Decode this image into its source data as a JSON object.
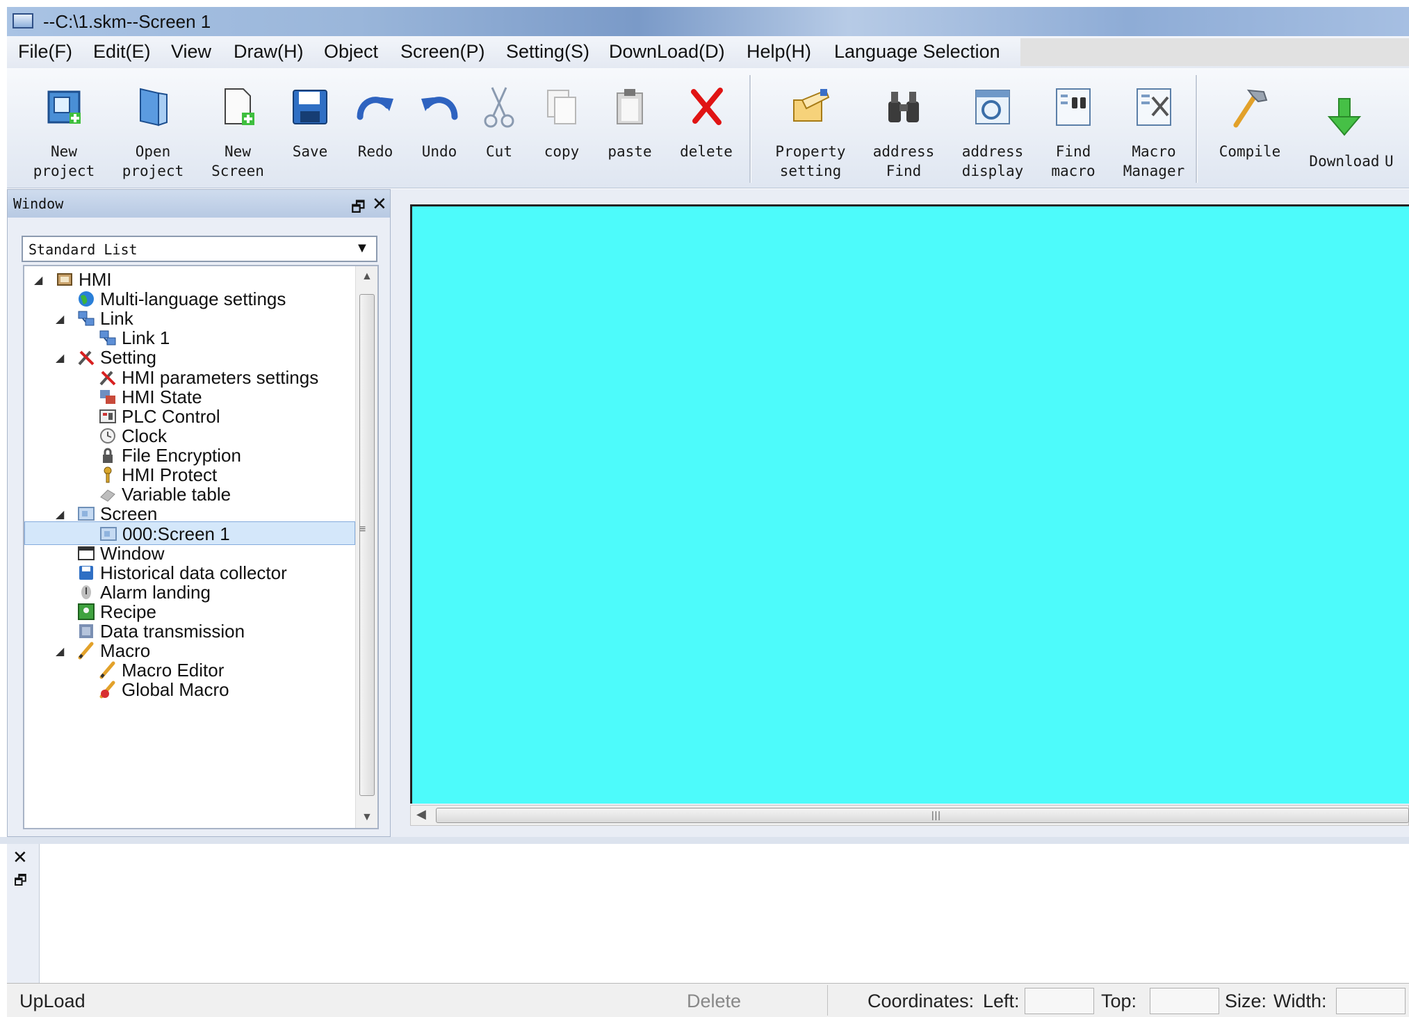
{
  "window": {
    "title": "--C:\\1.skm--Screen 1"
  },
  "menu": [
    "File(F)",
    "Edit(E)",
    "View",
    "Draw(H)",
    "Object",
    "Screen(P)",
    "Setting(S)",
    "DownLoad(D)",
    "Help(H)",
    "Language Selection"
  ],
  "toolbar": {
    "buttons": [
      {
        "label": "New\nproject",
        "icon": "new-project-icon"
      },
      {
        "label": "Open\nproject",
        "icon": "open-project-icon"
      },
      {
        "label": "New\nScreen",
        "icon": "new-screen-icon"
      },
      {
        "label": "Save",
        "icon": "save-icon"
      },
      {
        "label": "Redo",
        "icon": "redo-icon"
      },
      {
        "label": "Undo",
        "icon": "undo-icon"
      },
      {
        "label": "Cut",
        "icon": "cut-icon"
      },
      {
        "label": "copy",
        "icon": "copy-icon"
      },
      {
        "label": "paste",
        "icon": "paste-icon"
      },
      {
        "label": "delete",
        "icon": "delete-icon"
      },
      {
        "label": "Property\nsetting",
        "icon": "property-setting-icon"
      },
      {
        "label": "address\nFind",
        "icon": "binoculars-icon"
      },
      {
        "label": "address\ndisplay",
        "icon": "address-display-icon"
      },
      {
        "label": "Find\nmacro",
        "icon": "find-macro-icon"
      },
      {
        "label": "Macro\nManager",
        "icon": "macro-manager-icon"
      },
      {
        "label": "Compile",
        "icon": "hammer-icon"
      },
      {
        "label": "Download",
        "icon": "download-arrow-icon"
      },
      {
        "label": "U",
        "icon": "upload-icon"
      }
    ]
  },
  "panel": {
    "title": "Window",
    "dropdown": "Standard List",
    "tree": [
      {
        "label": "HMI",
        "level": 0,
        "toggle": true,
        "icon": "hmi-icon"
      },
      {
        "label": "Multi-language settings",
        "level": 1,
        "toggle": false,
        "icon": "globe-icon"
      },
      {
        "label": "Link",
        "level": 1,
        "toggle": true,
        "icon": "link-icon"
      },
      {
        "label": "Link 1",
        "level": 2,
        "toggle": false,
        "icon": "link-icon"
      },
      {
        "label": "Setting",
        "level": 1,
        "toggle": true,
        "icon": "tools-icon"
      },
      {
        "label": "HMI parameters settings",
        "level": 2,
        "toggle": false,
        "icon": "tools-icon"
      },
      {
        "label": "HMI State",
        "level": 2,
        "toggle": false,
        "icon": "hmi-state-icon"
      },
      {
        "label": "PLC Control",
        "level": 2,
        "toggle": false,
        "icon": "plc-control-icon"
      },
      {
        "label": "Clock",
        "level": 2,
        "toggle": false,
        "icon": "clock-icon"
      },
      {
        "label": "File Encryption",
        "level": 2,
        "toggle": false,
        "icon": "lock-icon"
      },
      {
        "label": "HMI Protect",
        "level": 2,
        "toggle": false,
        "icon": "key-icon"
      },
      {
        "label": "Variable table",
        "level": 2,
        "toggle": false,
        "icon": "eraser-icon"
      },
      {
        "label": "Screen",
        "level": 1,
        "toggle": true,
        "icon": "screen-icon"
      },
      {
        "label": "000:Screen 1",
        "level": 2,
        "toggle": false,
        "icon": "screen-icon",
        "selected": true
      },
      {
        "label": "Window",
        "level": 1,
        "toggle": false,
        "icon": "window-icon"
      },
      {
        "label": "Historical data collector",
        "level": 1,
        "toggle": false,
        "icon": "disk-icon"
      },
      {
        "label": "Alarm landing",
        "level": 1,
        "toggle": false,
        "icon": "alarm-icon"
      },
      {
        "label": "Recipe",
        "level": 1,
        "toggle": false,
        "icon": "recipe-icon"
      },
      {
        "label": "Data transmission",
        "level": 1,
        "toggle": false,
        "icon": "data-transmission-icon"
      },
      {
        "label": "Macro",
        "level": 1,
        "toggle": true,
        "icon": "pencil-icon"
      },
      {
        "label": "Macro Editor",
        "level": 2,
        "toggle": false,
        "icon": "pencil-icon"
      },
      {
        "label": "Global Macro",
        "level": 2,
        "toggle": false,
        "icon": "global-macro-icon"
      }
    ]
  },
  "canvas": {
    "background": "#4dfbfb"
  },
  "statusbar": {
    "left": "UpLoad",
    "delete": "Delete",
    "coordinates": "Coordinates:",
    "left_label": "Left:",
    "top_label": "Top:",
    "size": "Size:",
    "width_label": "Width:",
    "left_value": "",
    "top_value": "",
    "width_value": ""
  }
}
